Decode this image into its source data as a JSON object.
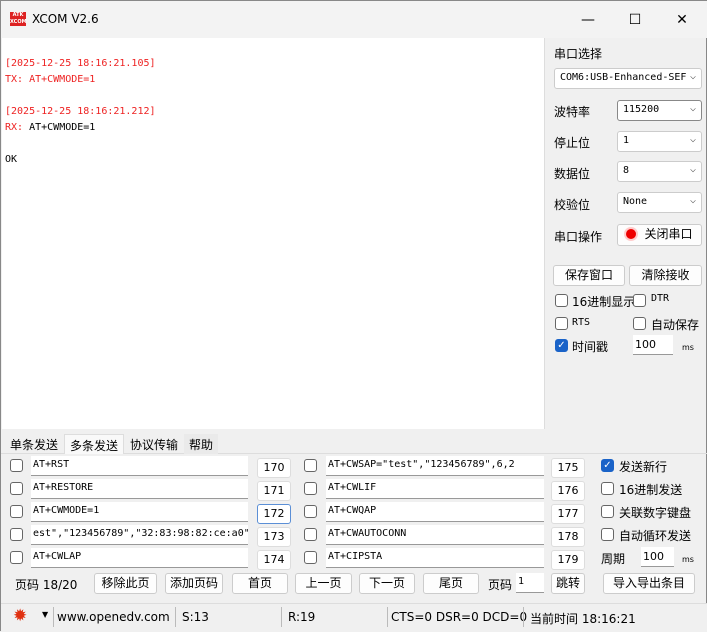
{
  "window": {
    "title": "XCOM V2.6",
    "logo": "ATK XCOM",
    "min": "—",
    "max": "☐",
    "close": "✕"
  },
  "receive": [
    {
      "text": "[2025-12-25 18:16:21.105]",
      "color": "red"
    },
    {
      "text": "TX: AT+CWMODE=1",
      "color": "red"
    },
    {
      "text": "",
      "color": ""
    },
    {
      "text": "[2025-12-25 18:16:21.212]",
      "color": "red"
    },
    {
      "prefix": "RX: ",
      "text": "AT+CWMODE=1"
    },
    {
      "text": "",
      "color": ""
    },
    {
      "text": "OK",
      "color": ""
    }
  ],
  "panel": {
    "port_label": "串口选择",
    "port_value": "COM6:USB-Enhanced-SEF",
    "baud_label": "波特率",
    "baud_value": "115200",
    "stop_label": "停止位",
    "stop_value": "1",
    "data_label": "数据位",
    "data_value": "8",
    "parity_label": "校验位",
    "parity_value": "None",
    "op_label": "串口操作",
    "op_button": "关闭串口",
    "save_window": "保存窗口",
    "clear_recv": "清除接收",
    "hex_display": "16进制显示",
    "dtr": "DTR",
    "rts": "RTS",
    "auto_save": "自动保存",
    "timestamp": "时间戳",
    "timestamp_checked": true,
    "timestamp_value": "100",
    "ms": "ms"
  },
  "tabs": [
    "单条发送",
    "多条发送",
    "协议传输",
    "帮助"
  ],
  "active_tab": 1,
  "rows_left": [
    {
      "text": "AT+RST",
      "num": "170"
    },
    {
      "text": "AT+RESTORE",
      "num": "171"
    },
    {
      "text": "AT+CWMODE=1",
      "num": "172"
    },
    {
      "text": "est\",\"123456789\",\"32:83:98:82:ce:a0\"",
      "num": "173"
    },
    {
      "text": "AT+CWLAP",
      "num": "174"
    }
  ],
  "rows_right": [
    {
      "text": "AT+CWSAP=\"test\",\"123456789\",6,2",
      "num": "175"
    },
    {
      "text": "AT+CWLIF",
      "num": "176"
    },
    {
      "text": "AT+CWQAP",
      "num": "177"
    },
    {
      "text": "AT+CWAUTOCONN",
      "num": "178"
    },
    {
      "text": "AT+CIPSTA",
      "num": "179"
    }
  ],
  "options": {
    "send_newline": "发送新行",
    "send_newline_checked": true,
    "hex_send": "16进制发送",
    "link_keypad": "关联数字键盘",
    "auto_loop": "自动循环发送",
    "period_label": "周期",
    "period_value": "100",
    "ms": "ms"
  },
  "pager": {
    "page_info": "页码 18/20",
    "remove": "移除此页",
    "add": "添加页码",
    "first": "首页",
    "prev": "上一页",
    "next": "下一页",
    "last": "尾页",
    "page_label": "页码",
    "page_value": "1",
    "jump": "跳转",
    "import_export": "导入导出条目"
  },
  "status": {
    "url": "www.openedv.com",
    "sent": "S:13",
    "recv": "R:19",
    "lines": "CTS=0 DSR=0 DCD=0",
    "time": "当前时间 18:16:21"
  }
}
